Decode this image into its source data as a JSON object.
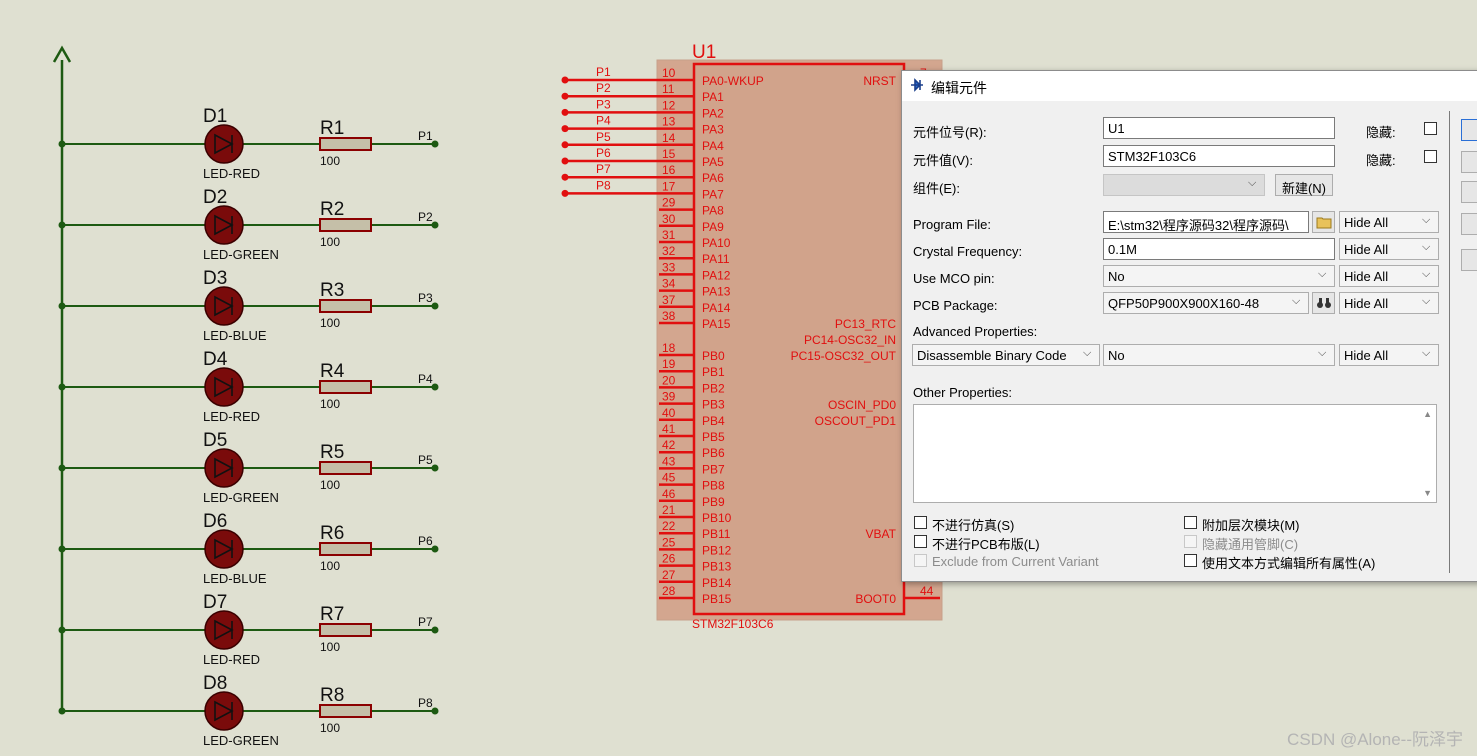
{
  "schematic": {
    "leds": [
      {
        "ref": "D1",
        "type": "LED-RED",
        "res": "R1",
        "val": "100",
        "net": "P1"
      },
      {
        "ref": "D2",
        "type": "LED-GREEN",
        "res": "R2",
        "val": "100",
        "net": "P2"
      },
      {
        "ref": "D3",
        "type": "LED-BLUE",
        "res": "R3",
        "val": "100",
        "net": "P3"
      },
      {
        "ref": "D4",
        "type": "LED-RED",
        "res": "R4",
        "val": "100",
        "net": "P4"
      },
      {
        "ref": "D5",
        "type": "LED-GREEN",
        "res": "R5",
        "val": "100",
        "net": "P5"
      },
      {
        "ref": "D6",
        "type": "LED-BLUE",
        "res": "R6",
        "val": "100",
        "net": "P6"
      },
      {
        "ref": "D7",
        "type": "LED-RED",
        "res": "R7",
        "val": "100",
        "net": "P7"
      },
      {
        "ref": "D8",
        "type": "LED-GREEN",
        "res": "R8",
        "val": "100",
        "net": "P8"
      }
    ],
    "chip": {
      "ref": "U1",
      "name": "STM32F103C6",
      "left_pins": [
        {
          "num": "10",
          "name": "PA0-WKUP",
          "net": "P1"
        },
        {
          "num": "11",
          "name": "PA1",
          "net": "P2"
        },
        {
          "num": "12",
          "name": "PA2",
          "net": "P3"
        },
        {
          "num": "13",
          "name": "PA3",
          "net": "P4"
        },
        {
          "num": "14",
          "name": "PA4",
          "net": "P5"
        },
        {
          "num": "15",
          "name": "PA5",
          "net": "P6"
        },
        {
          "num": "16",
          "name": "PA6",
          "net": "P7"
        },
        {
          "num": "17",
          "name": "PA7",
          "net": "P8"
        },
        {
          "num": "29",
          "name": "PA8"
        },
        {
          "num": "30",
          "name": "PA9"
        },
        {
          "num": "31",
          "name": "PA10"
        },
        {
          "num": "32",
          "name": "PA11"
        },
        {
          "num": "33",
          "name": "PA12"
        },
        {
          "num": "34",
          "name": "PA13"
        },
        {
          "num": "37",
          "name": "PA14"
        },
        {
          "num": "38",
          "name": "PA15"
        },
        {
          "num": "18",
          "name": "PB0"
        },
        {
          "num": "19",
          "name": "PB1"
        },
        {
          "num": "20",
          "name": "PB2"
        },
        {
          "num": "39",
          "name": "PB3"
        },
        {
          "num": "40",
          "name": "PB4"
        },
        {
          "num": "41",
          "name": "PB5"
        },
        {
          "num": "42",
          "name": "PB6"
        },
        {
          "num": "43",
          "name": "PB7"
        },
        {
          "num": "45",
          "name": "PB8"
        },
        {
          "num": "46",
          "name": "PB9"
        },
        {
          "num": "21",
          "name": "PB10"
        },
        {
          "num": "22",
          "name": "PB11"
        },
        {
          "num": "25",
          "name": "PB12"
        },
        {
          "num": "26",
          "name": "PB13"
        },
        {
          "num": "27",
          "name": "PB14"
        },
        {
          "num": "28",
          "name": "PB15"
        }
      ],
      "right_pins": [
        {
          "name": "NRST",
          "num": "7"
        },
        {
          "name": "PC13_RTC"
        },
        {
          "name": "PC14-OSC32_IN"
        },
        {
          "name": "PC15-OSC32_OUT"
        },
        {
          "name": "OSCIN_PD0"
        },
        {
          "name": "OSCOUT_PD1"
        },
        {
          "name": "VBAT"
        },
        {
          "name": "BOOT0",
          "num": "44"
        }
      ]
    }
  },
  "dialog": {
    "title": "编辑元件",
    "ref_label": "元件位号(R):",
    "ref_value": "U1",
    "value_label": "元件值(V):",
    "value_value": "STM32F103C6",
    "group_label": "组件(E):",
    "new_button": "新建(N)",
    "hidden_label": "隐藏:",
    "props": [
      {
        "label": "Program File:",
        "value": "E:\\stm32\\程序源码32\\程序源码\\",
        "vis": "Hide All"
      },
      {
        "label": "Crystal Frequency:",
        "value": "0.1M",
        "vis": "Hide All"
      },
      {
        "label": "Use MCO pin:",
        "value": "No",
        "vis": "Hide All"
      },
      {
        "label": "PCB Package:",
        "value": "QFP50P900X900X160-48",
        "vis": "Hide All"
      }
    ],
    "advanced_label": "Advanced Properties:",
    "advanced": {
      "name": "Disassemble Binary Code",
      "value": "No",
      "vis": "Hide All"
    },
    "other_label": "Other Properties:",
    "checks": {
      "no_sim": "不进行仿真(S)",
      "no_pcb": "不进行PCB布版(L)",
      "exclude_variant": "Exclude from Current Variant",
      "attach_hier": "附加层次模块(M)",
      "hide_common_pins": "隐藏通用管脚(C)",
      "edit_text": "使用文本方式编辑所有属性(A)"
    }
  },
  "watermark": "CSDN @Alone--阮泽宇"
}
